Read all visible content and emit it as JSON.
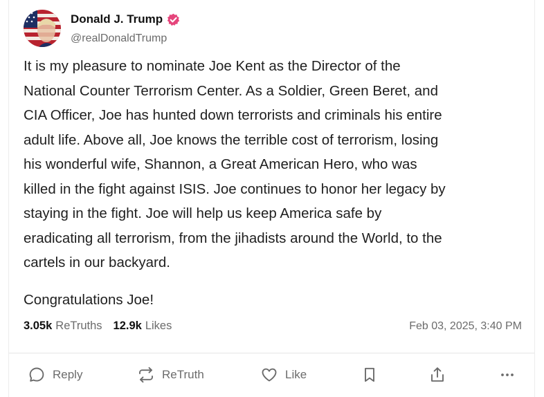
{
  "author": {
    "name": "Donald J. Trump",
    "handle": "@realDonaldTrump",
    "verified_color": "#e5457b"
  },
  "post": {
    "body": "It is my pleasure to nominate Joe Kent as the Director of the\nNational Counter Terrorism Center. As a Soldier, Green Beret, and\nCIA Officer, Joe has hunted down terrorists and criminals his entire\nadult life. Above all, Joe knows the terrible cost of terrorism, losing\nhis wonderful wife, Shannon, a Great American Hero, who was\nkilled in the fight against ISIS. Joe continues to honor her legacy by\nstaying in the fight. Joe will help us keep America safe by\neradicating all terrorism, from the jihadists around the World, to the\ncartels in our backyard.",
    "closing": "Congratulations Joe!"
  },
  "stats": {
    "retruths_count": "3.05k",
    "retruths_label": "ReTruths",
    "likes_count": "12.9k",
    "likes_label": "Likes",
    "timestamp": "Feb 03, 2025, 3:40 PM"
  },
  "actions": {
    "reply_label": "Reply",
    "retruth_label": "ReTruth",
    "like_label": "Like",
    "icons": [
      "reply-icon",
      "retruth-icon",
      "like-icon",
      "bookmark-icon",
      "share-icon",
      "more-icon"
    ]
  }
}
